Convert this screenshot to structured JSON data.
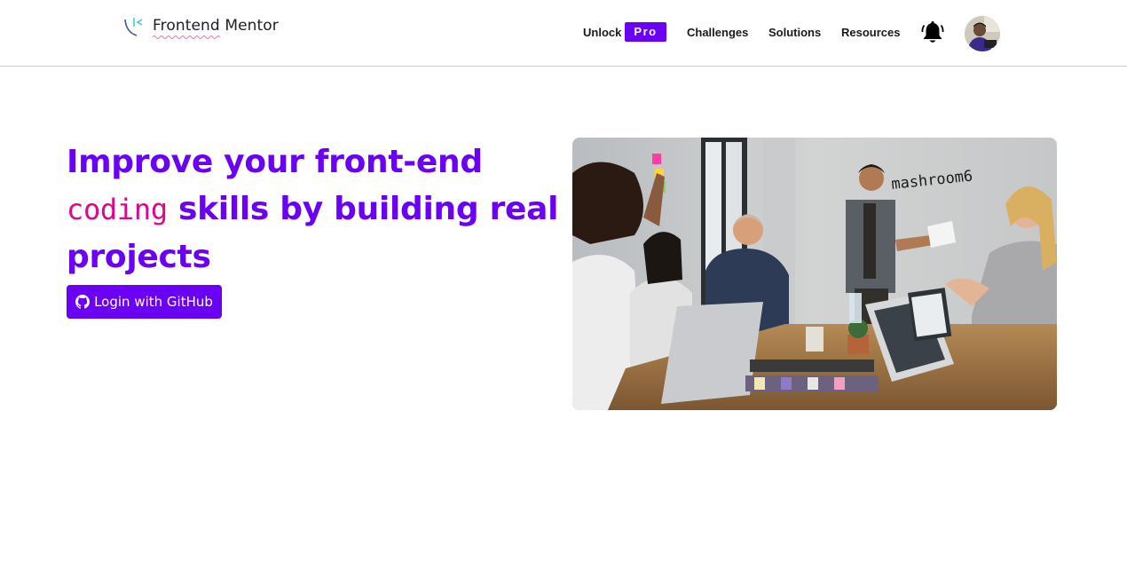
{
  "header": {
    "logo_text": "Frontend Mentor",
    "nav": {
      "unlock_label": "Unlock",
      "pro_label": "Pro",
      "challenges_label": "Challenges",
      "solutions_label": "Solutions",
      "resources_label": "Resources"
    },
    "icons": {
      "notifications": "bell-icon",
      "profile": "avatar"
    }
  },
  "hero": {
    "title_part1": "Improve your front-end",
    "title_code": "coding",
    "title_part2": "skills by building real projects",
    "github_button_label": "Login with GitHub",
    "github_icon": "github-icon",
    "image_sign_text": "mashroom6"
  },
  "colors": {
    "brand_purple": "#6a00f4",
    "accent_pink": "#e1058c",
    "text_dark": "#1a1a1a"
  }
}
